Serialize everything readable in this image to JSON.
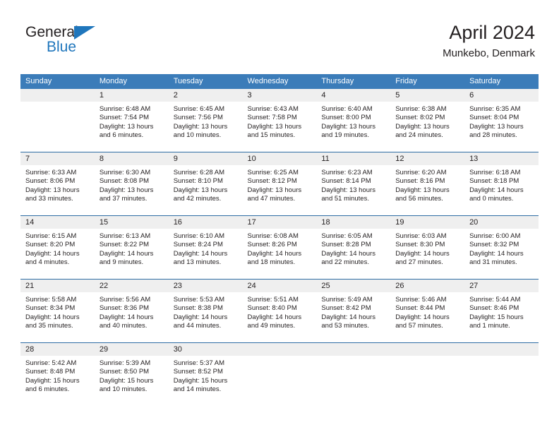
{
  "brand": {
    "name_part1": "General",
    "name_part2": "Blue",
    "triangle_icon": "triangle-icon",
    "accent_color": "#1f76bc"
  },
  "header": {
    "month_title": "April 2024",
    "location": "Munkebo, Denmark"
  },
  "theme": {
    "header_bg": "#3b7cb9",
    "daynum_bg": "#efefef",
    "rule_color": "#2e6da4",
    "text_color": "#231f20"
  },
  "weekdays": [
    "Sunday",
    "Monday",
    "Tuesday",
    "Wednesday",
    "Thursday",
    "Friday",
    "Saturday"
  ],
  "weeks": [
    [
      {
        "day": "",
        "sunrise": "",
        "sunset": "",
        "daylight1": "",
        "daylight2": "",
        "empty": true
      },
      {
        "day": "1",
        "sunrise": "Sunrise: 6:48 AM",
        "sunset": "Sunset: 7:54 PM",
        "daylight1": "Daylight: 13 hours",
        "daylight2": "and 6 minutes."
      },
      {
        "day": "2",
        "sunrise": "Sunrise: 6:45 AM",
        "sunset": "Sunset: 7:56 PM",
        "daylight1": "Daylight: 13 hours",
        "daylight2": "and 10 minutes."
      },
      {
        "day": "3",
        "sunrise": "Sunrise: 6:43 AM",
        "sunset": "Sunset: 7:58 PM",
        "daylight1": "Daylight: 13 hours",
        "daylight2": "and 15 minutes."
      },
      {
        "day": "4",
        "sunrise": "Sunrise: 6:40 AM",
        "sunset": "Sunset: 8:00 PM",
        "daylight1": "Daylight: 13 hours",
        "daylight2": "and 19 minutes."
      },
      {
        "day": "5",
        "sunrise": "Sunrise: 6:38 AM",
        "sunset": "Sunset: 8:02 PM",
        "daylight1": "Daylight: 13 hours",
        "daylight2": "and 24 minutes."
      },
      {
        "day": "6",
        "sunrise": "Sunrise: 6:35 AM",
        "sunset": "Sunset: 8:04 PM",
        "daylight1": "Daylight: 13 hours",
        "daylight2": "and 28 minutes."
      }
    ],
    [
      {
        "day": "7",
        "sunrise": "Sunrise: 6:33 AM",
        "sunset": "Sunset: 8:06 PM",
        "daylight1": "Daylight: 13 hours",
        "daylight2": "and 33 minutes."
      },
      {
        "day": "8",
        "sunrise": "Sunrise: 6:30 AM",
        "sunset": "Sunset: 8:08 PM",
        "daylight1": "Daylight: 13 hours",
        "daylight2": "and 37 minutes."
      },
      {
        "day": "9",
        "sunrise": "Sunrise: 6:28 AM",
        "sunset": "Sunset: 8:10 PM",
        "daylight1": "Daylight: 13 hours",
        "daylight2": "and 42 minutes."
      },
      {
        "day": "10",
        "sunrise": "Sunrise: 6:25 AM",
        "sunset": "Sunset: 8:12 PM",
        "daylight1": "Daylight: 13 hours",
        "daylight2": "and 47 minutes."
      },
      {
        "day": "11",
        "sunrise": "Sunrise: 6:23 AM",
        "sunset": "Sunset: 8:14 PM",
        "daylight1": "Daylight: 13 hours",
        "daylight2": "and 51 minutes."
      },
      {
        "day": "12",
        "sunrise": "Sunrise: 6:20 AM",
        "sunset": "Sunset: 8:16 PM",
        "daylight1": "Daylight: 13 hours",
        "daylight2": "and 56 minutes."
      },
      {
        "day": "13",
        "sunrise": "Sunrise: 6:18 AM",
        "sunset": "Sunset: 8:18 PM",
        "daylight1": "Daylight: 14 hours",
        "daylight2": "and 0 minutes."
      }
    ],
    [
      {
        "day": "14",
        "sunrise": "Sunrise: 6:15 AM",
        "sunset": "Sunset: 8:20 PM",
        "daylight1": "Daylight: 14 hours",
        "daylight2": "and 4 minutes."
      },
      {
        "day": "15",
        "sunrise": "Sunrise: 6:13 AM",
        "sunset": "Sunset: 8:22 PM",
        "daylight1": "Daylight: 14 hours",
        "daylight2": "and 9 minutes."
      },
      {
        "day": "16",
        "sunrise": "Sunrise: 6:10 AM",
        "sunset": "Sunset: 8:24 PM",
        "daylight1": "Daylight: 14 hours",
        "daylight2": "and 13 minutes."
      },
      {
        "day": "17",
        "sunrise": "Sunrise: 6:08 AM",
        "sunset": "Sunset: 8:26 PM",
        "daylight1": "Daylight: 14 hours",
        "daylight2": "and 18 minutes."
      },
      {
        "day": "18",
        "sunrise": "Sunrise: 6:05 AM",
        "sunset": "Sunset: 8:28 PM",
        "daylight1": "Daylight: 14 hours",
        "daylight2": "and 22 minutes."
      },
      {
        "day": "19",
        "sunrise": "Sunrise: 6:03 AM",
        "sunset": "Sunset: 8:30 PM",
        "daylight1": "Daylight: 14 hours",
        "daylight2": "and 27 minutes."
      },
      {
        "day": "20",
        "sunrise": "Sunrise: 6:00 AM",
        "sunset": "Sunset: 8:32 PM",
        "daylight1": "Daylight: 14 hours",
        "daylight2": "and 31 minutes."
      }
    ],
    [
      {
        "day": "21",
        "sunrise": "Sunrise: 5:58 AM",
        "sunset": "Sunset: 8:34 PM",
        "daylight1": "Daylight: 14 hours",
        "daylight2": "and 35 minutes."
      },
      {
        "day": "22",
        "sunrise": "Sunrise: 5:56 AM",
        "sunset": "Sunset: 8:36 PM",
        "daylight1": "Daylight: 14 hours",
        "daylight2": "and 40 minutes."
      },
      {
        "day": "23",
        "sunrise": "Sunrise: 5:53 AM",
        "sunset": "Sunset: 8:38 PM",
        "daylight1": "Daylight: 14 hours",
        "daylight2": "and 44 minutes."
      },
      {
        "day": "24",
        "sunrise": "Sunrise: 5:51 AM",
        "sunset": "Sunset: 8:40 PM",
        "daylight1": "Daylight: 14 hours",
        "daylight2": "and 49 minutes."
      },
      {
        "day": "25",
        "sunrise": "Sunrise: 5:49 AM",
        "sunset": "Sunset: 8:42 PM",
        "daylight1": "Daylight: 14 hours",
        "daylight2": "and 53 minutes."
      },
      {
        "day": "26",
        "sunrise": "Sunrise: 5:46 AM",
        "sunset": "Sunset: 8:44 PM",
        "daylight1": "Daylight: 14 hours",
        "daylight2": "and 57 minutes."
      },
      {
        "day": "27",
        "sunrise": "Sunrise: 5:44 AM",
        "sunset": "Sunset: 8:46 PM",
        "daylight1": "Daylight: 15 hours",
        "daylight2": "and 1 minute."
      }
    ],
    [
      {
        "day": "28",
        "sunrise": "Sunrise: 5:42 AM",
        "sunset": "Sunset: 8:48 PM",
        "daylight1": "Daylight: 15 hours",
        "daylight2": "and 6 minutes."
      },
      {
        "day": "29",
        "sunrise": "Sunrise: 5:39 AM",
        "sunset": "Sunset: 8:50 PM",
        "daylight1": "Daylight: 15 hours",
        "daylight2": "and 10 minutes."
      },
      {
        "day": "30",
        "sunrise": "Sunrise: 5:37 AM",
        "sunset": "Sunset: 8:52 PM",
        "daylight1": "Daylight: 15 hours",
        "daylight2": "and 14 minutes."
      },
      {
        "day": "",
        "sunrise": "",
        "sunset": "",
        "daylight1": "",
        "daylight2": "",
        "empty": true
      },
      {
        "day": "",
        "sunrise": "",
        "sunset": "",
        "daylight1": "",
        "daylight2": "",
        "empty": true
      },
      {
        "day": "",
        "sunrise": "",
        "sunset": "",
        "daylight1": "",
        "daylight2": "",
        "empty": true
      },
      {
        "day": "",
        "sunrise": "",
        "sunset": "",
        "daylight1": "",
        "daylight2": "",
        "empty": true
      }
    ]
  ]
}
